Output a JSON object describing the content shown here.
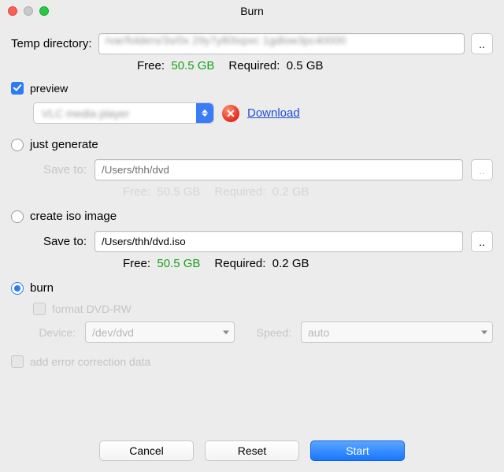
{
  "title": "Burn",
  "tempDir": {
    "label": "Temp directory:",
    "value": "/var/folders/3s/0x 29y7y80txpxc 1gdlow3pc40000",
    "browse": "..",
    "freeLabel": "Free:",
    "freeValue": "50.5 GB",
    "reqLabel": "Required:",
    "reqValue": "0.5 GB"
  },
  "preview": {
    "label": "preview",
    "checked": true,
    "player": "VLC media player",
    "downloadLink": "Download",
    "statusIcon": "error-icon"
  },
  "justGenerate": {
    "label": "just generate",
    "selected": false,
    "saveToLabel": "Save to:",
    "saveToValue": "/Users/thh/dvd",
    "browse": "..",
    "freeLabel": "Free:",
    "freeValue": "50.5 GB",
    "reqLabel": "Required:",
    "reqValue": "0.2 GB"
  },
  "createIso": {
    "label": "create iso image",
    "selected": false,
    "saveToLabel": "Save to:",
    "saveToValue": "/Users/thh/dvd.iso",
    "browse": "..",
    "freeLabel": "Free:",
    "freeValue": "50.5 GB",
    "reqLabel": "Required:",
    "reqValue": "0.2 GB"
  },
  "burn": {
    "label": "burn",
    "selected": true,
    "formatLabel": "format DVD-RW",
    "formatChecked": false,
    "deviceLabel": "Device:",
    "deviceValue": "/dev/dvd",
    "speedLabel": "Speed:",
    "speedValue": "auto"
  },
  "addErrorCorrection": {
    "label": "add error correction data",
    "checked": false
  },
  "buttons": {
    "cancel": "Cancel",
    "reset": "Reset",
    "start": "Start"
  }
}
